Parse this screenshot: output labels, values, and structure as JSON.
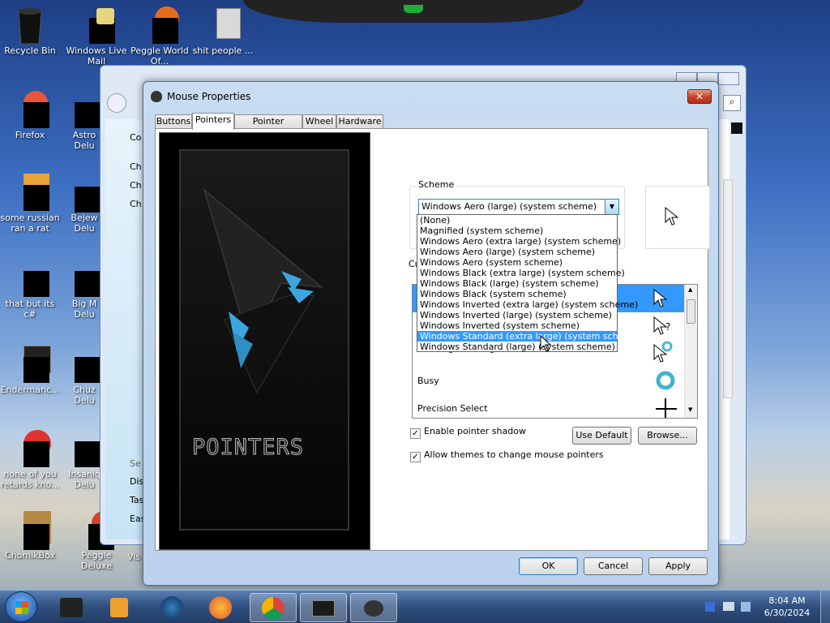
{
  "desktop": {
    "icons": [
      {
        "label": "Recycle Bin"
      },
      {
        "label": "Windows Live Mail"
      },
      {
        "label": "Peggle World Of..."
      },
      {
        "label": "shit people ..."
      },
      {
        "label": "Firefox"
      },
      {
        "label": "Astro Delu"
      },
      {
        "label": "some russian ran a rat"
      },
      {
        "label": "Bejew Delu"
      },
      {
        "label": "that but its c#"
      },
      {
        "label": "Big M Delu"
      },
      {
        "label": "Endermanc..."
      },
      {
        "label": "Chuz Delu"
      },
      {
        "label": "none of you retards kno..."
      },
      {
        "label": "Insaniq Delu"
      },
      {
        "label": "ChomikBox"
      },
      {
        "label": "Peggle Deluxe"
      },
      {
        "label": "Vis"
      }
    ]
  },
  "bg_window": {
    "items": [
      "Co",
      "Ch",
      "Ch",
      "Ch",
      "Se",
      "Dis",
      "Tas",
      "Eas"
    ]
  },
  "dialog": {
    "title": "Mouse Properties",
    "close_label": "✕",
    "tabs": [
      "Buttons",
      "Pointers",
      "Pointer Options",
      "Wheel",
      "Hardware"
    ],
    "art_text": "POINTERS",
    "scheme_label": "Scheme",
    "scheme_value": "Windows Aero (large) (system scheme)",
    "scheme_options": [
      "(None)",
      "Magnified (system scheme)",
      "Windows Aero (extra large) (system scheme)",
      "Windows Aero (large) (system scheme)",
      "Windows Aero (system scheme)",
      "Windows Black (extra large) (system scheme)",
      "Windows Black (large) (system scheme)",
      "Windows Black (system scheme)",
      "Windows Inverted (extra large) (system scheme)",
      "Windows Inverted (large) (system scheme)",
      "Windows Inverted (system scheme)",
      "Windows Standard (extra large) (system scheme)",
      "Windows Standard (large) (system scheme)"
    ],
    "highlighted_option": 11,
    "customize_label": "Cu",
    "cursor_rows": [
      "",
      "",
      "Working in Background",
      "Busy",
      "Precision Select"
    ],
    "shadow_label": "Enable pointer shadow",
    "themes_label": "Allow themes to change mouse pointers",
    "use_default_label": "Use Default",
    "browse_label": "Browse...",
    "ok_label": "OK",
    "cancel_label": "Cancel",
    "apply_label": "Apply"
  },
  "taskbar": {
    "time": "8:04 AM",
    "date": "6/30/2024"
  },
  "colors": {
    "highlight": "#3399ff",
    "close_red": "#c8452b",
    "accent_blue": "#3c7fb1"
  }
}
